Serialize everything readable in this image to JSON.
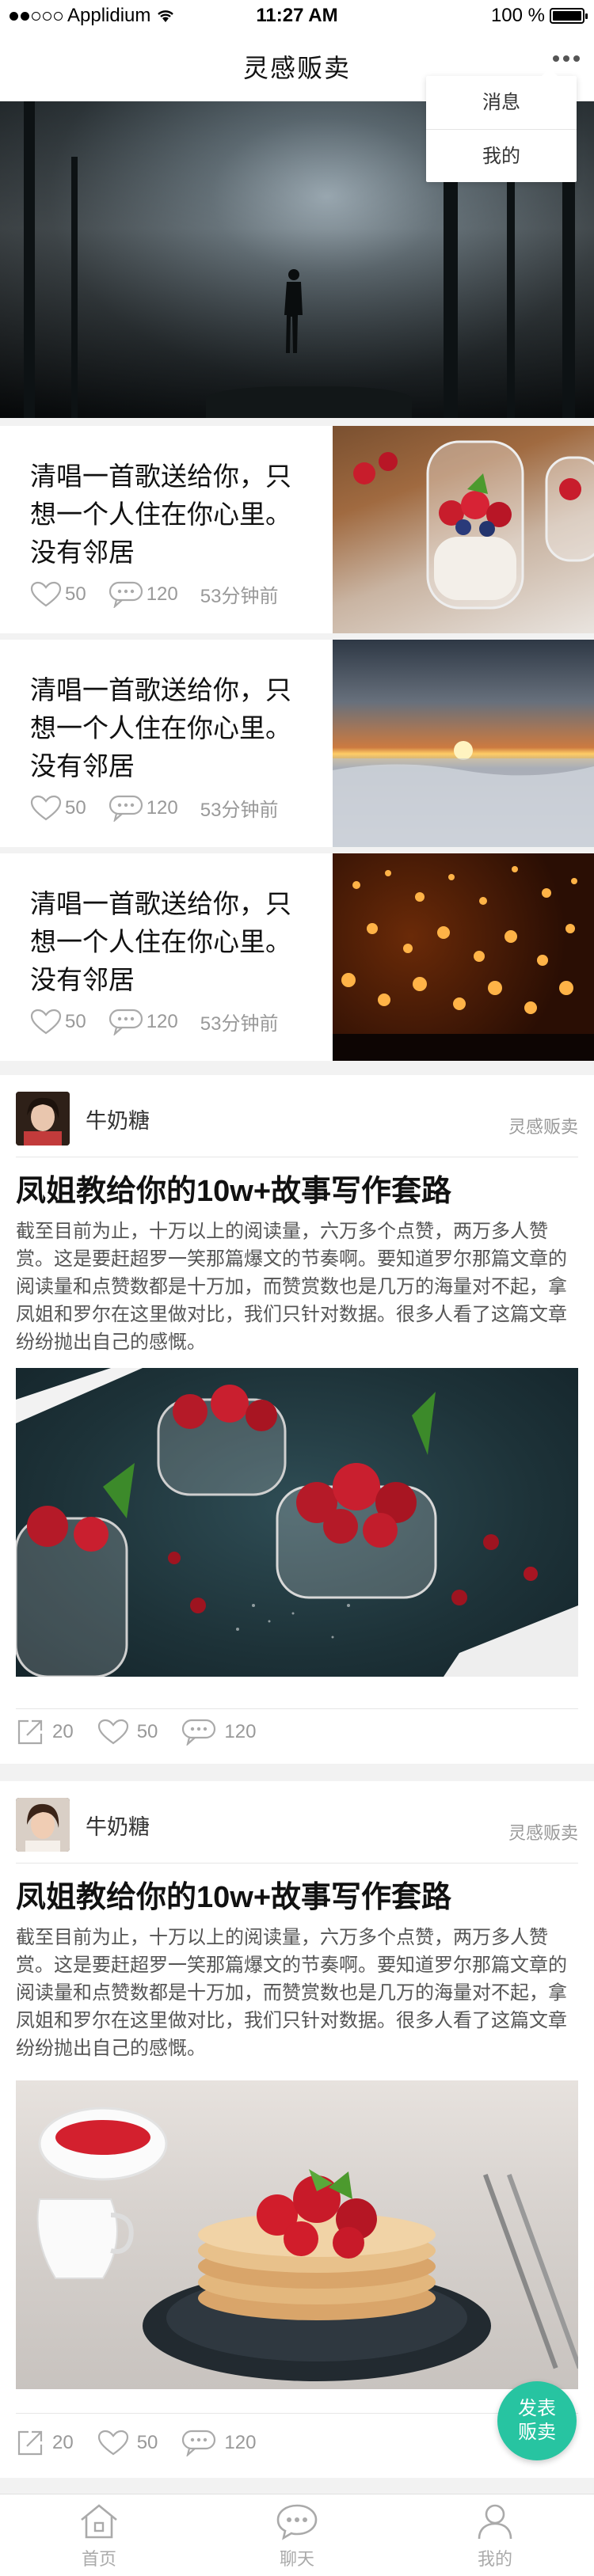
{
  "status_bar": {
    "carrier": "Applidium",
    "time": "11:27 AM",
    "battery": "100 %"
  },
  "nav": {
    "title": "灵感贩卖"
  },
  "dropdown": {
    "items": [
      {
        "label": "消息"
      },
      {
        "label": "我的"
      }
    ]
  },
  "articles": [
    {
      "title": "清唱一首歌送给你，只想一个人住在你心里。没有邻居",
      "likes": "50",
      "comments": "120",
      "time": "53分钟前"
    },
    {
      "title": "清唱一首歌送给你，只想一个人住在你心里。没有邻居",
      "likes": "50",
      "comments": "120",
      "time": "53分钟前"
    },
    {
      "title": "清唱一首歌送给你，只想一个人住在你心里。没有邻居",
      "likes": "50",
      "comments": "120",
      "time": "53分钟前"
    }
  ],
  "posts": [
    {
      "author": "牛奶糖",
      "source": "灵感贩卖",
      "title": "凤姐教给你的10w+故事写作套路",
      "body": "截至目前为止，十万以上的阅读量，六万多个点赞，两万多人赞赏。这是要赶超罗一笑那篇爆文的节奏啊。要知道罗尔那篇文章的阅读量和点赞数都是十万加，而赞赏数也是几万的海量对不起，拿凤姐和罗尔在这里做对比，我们只针对数据。很多人看了这篇文章纷纷抛出自己的感慨。",
      "shares": "20",
      "likes": "50",
      "comments": "120"
    },
    {
      "author": "牛奶糖",
      "source": "灵感贩卖",
      "title": "凤姐教给你的10w+故事写作套路",
      "body": "截至目前为止，十万以上的阅读量，六万多个点赞，两万多人赞赏。这是要赶超罗一笑那篇爆文的节奏啊。要知道罗尔那篇文章的阅读量和点赞数都是十万加，而赞赏数也是几万的海量对不起，拿凤姐和罗尔在这里做对比，我们只针对数据。很多人看了这篇文章纷纷抛出自己的感慨。",
      "shares": "20",
      "likes": "50",
      "comments": "120"
    }
  ],
  "fab": {
    "line1": "发表",
    "line2": "贩卖"
  },
  "tabbar": {
    "tabs": [
      {
        "label": "首页"
      },
      {
        "label": "聊天"
      },
      {
        "label": "我的"
      }
    ]
  },
  "colors": {
    "accent": "#27c4a1",
    "meta": "#999999"
  },
  "icons": [
    "signal-icon",
    "wifi-icon",
    "battery-icon",
    "more-icon",
    "heart-icon",
    "comment-icon",
    "share-icon",
    "home-icon",
    "chat-icon",
    "user-icon"
  ]
}
